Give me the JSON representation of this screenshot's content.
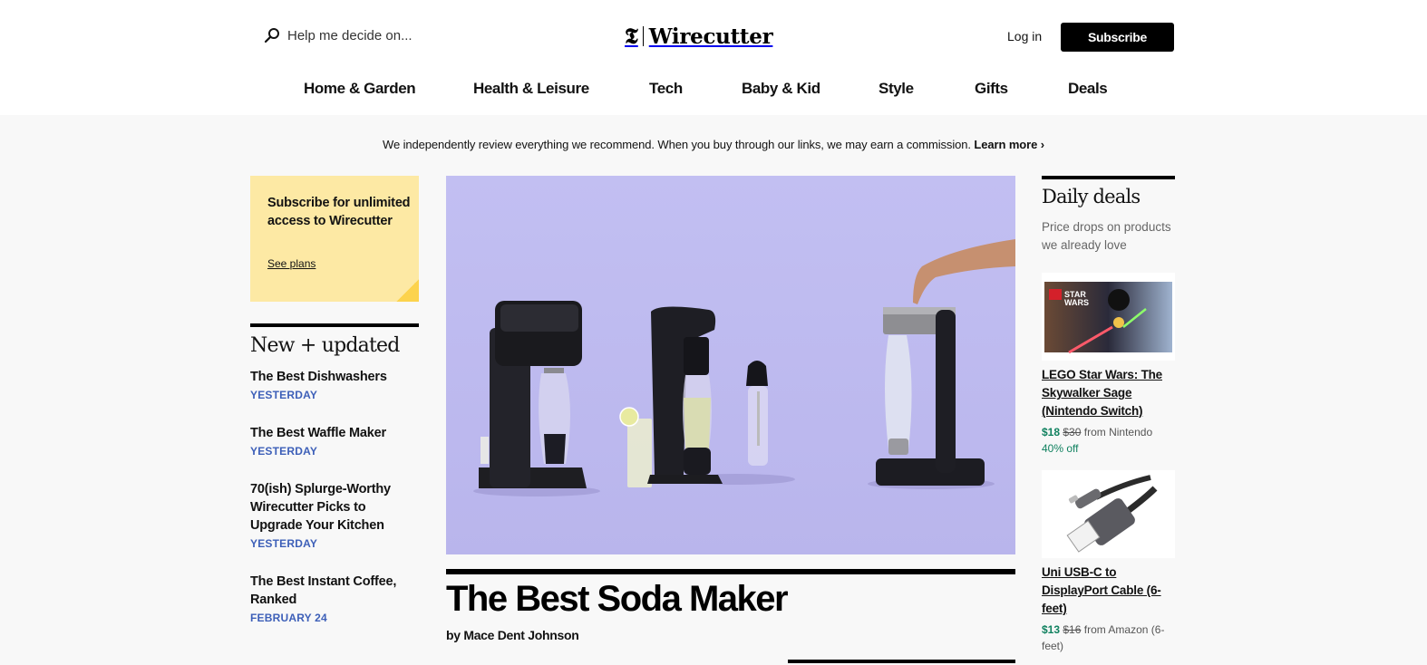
{
  "header": {
    "search_placeholder": "Help me decide on...",
    "logo_mark": "𝕿",
    "logo_text": "Wirecutter",
    "login_label": "Log in",
    "subscribe_label": "Subscribe"
  },
  "nav": {
    "items": [
      {
        "label": "Home & Garden"
      },
      {
        "label": "Health & Leisure"
      },
      {
        "label": "Tech"
      },
      {
        "label": "Baby & Kid"
      },
      {
        "label": "Style"
      },
      {
        "label": "Gifts"
      },
      {
        "label": "Deals"
      }
    ]
  },
  "disclosure": {
    "text": "We independently review everything we recommend. When you buy through our links, we may earn a commission.",
    "link_label": "Learn more ›"
  },
  "promo": {
    "title": "Subscribe for unlimited access to Wirecutter",
    "link_label": "See plans"
  },
  "new_updated": {
    "heading": "New + updated",
    "items": [
      {
        "title": "The Best Dishwashers",
        "date": "YESTERDAY"
      },
      {
        "title": "The Best Waffle Maker",
        "date": "YESTERDAY"
      },
      {
        "title": "70(ish) Splurge-Worthy Wirecutter Picks to Upgrade Your Kitchen",
        "date": "YESTERDAY"
      },
      {
        "title": "The Best Instant Coffee, Ranked",
        "date": "FEBRUARY 24"
      }
    ]
  },
  "feature": {
    "image_alt": "Soda makers on a lavender background",
    "title": "The Best Soda Maker",
    "byline": "by Mace Dent Johnson"
  },
  "daily_deals": {
    "heading": "Daily deals",
    "subheading": "Price drops on products we already love",
    "items": [
      {
        "name": "LEGO Star Wars: The Skywalker Sage (Nintendo Switch)",
        "price": "$18",
        "was_price": "$30",
        "source": "from Nintendo",
        "discount": "40% off"
      },
      {
        "name": "Uni USB-C to DisplayPort Cable (6-feet)",
        "price": "$13",
        "was_price": "$16",
        "source": "from Amazon (6-feet)"
      }
    ]
  },
  "colors": {
    "accent_date": "#3d5fb8",
    "deal_green": "#10815f",
    "promo_bg": "#fde9a4",
    "hero_bg": "#c0bdf0"
  }
}
